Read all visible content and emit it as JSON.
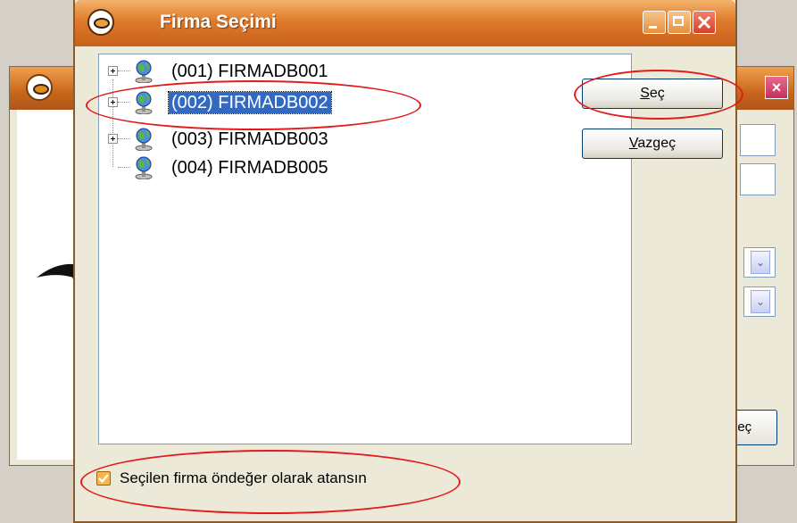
{
  "background_window": {
    "close_glyph": "×",
    "partial_button_label": "geç",
    "combo_glyph": "⌄"
  },
  "dialog": {
    "title": "Firma Seçimi",
    "tree": {
      "items": [
        {
          "label": "(001) FIRMADB001",
          "expandable": true,
          "selected": false
        },
        {
          "label": "(002) FIRMADB002",
          "expandable": true,
          "selected": true
        },
        {
          "label": "(003) FIRMADB003",
          "expandable": true,
          "selected": false
        },
        {
          "label": "(004) FIRMADB005",
          "expandable": false,
          "selected": false
        }
      ]
    },
    "buttons": {
      "select_mnemonic": "S",
      "select_rest": "eç",
      "cancel_mnemonic": "V",
      "cancel_rest": "azgeç"
    },
    "default_checkbox": {
      "label": "Seçilen firma öndeğer olarak atansın",
      "checked": true
    }
  },
  "colors": {
    "annotation": "#e21b1b",
    "selection": "#316ac5",
    "titlebar": "#de7a2c"
  }
}
